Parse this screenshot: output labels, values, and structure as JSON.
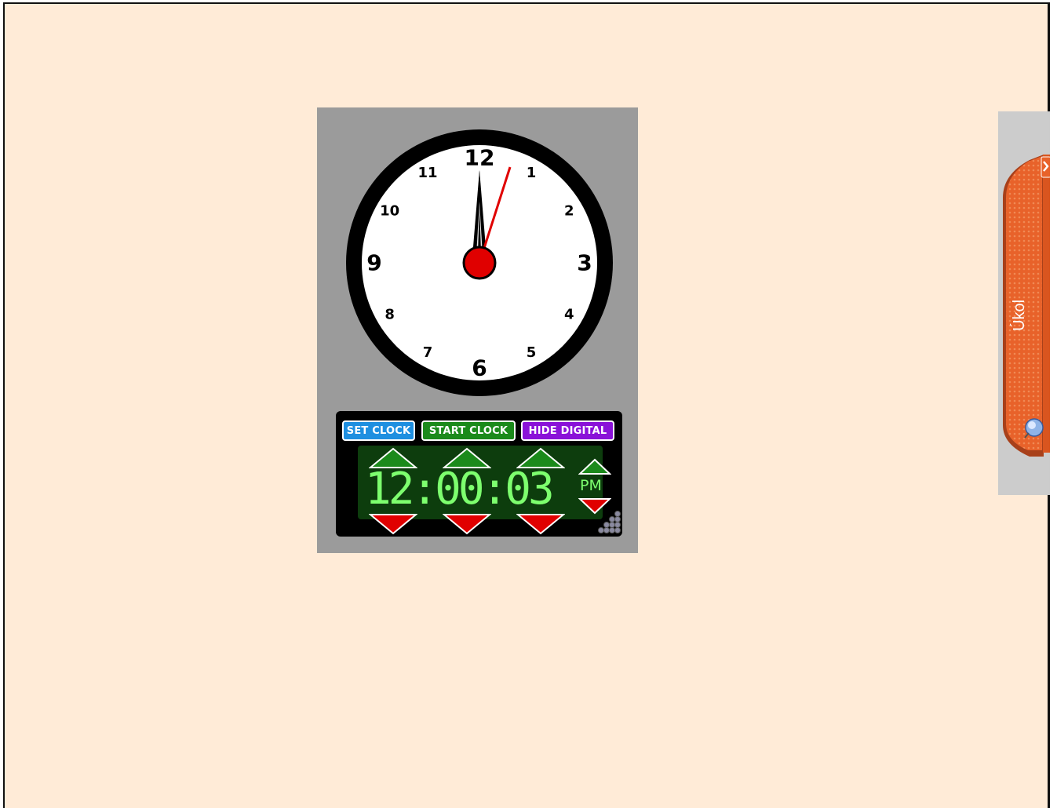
{
  "clock": {
    "face_numbers": [
      "12",
      "1",
      "2",
      "3",
      "4",
      "5",
      "6",
      "7",
      "8",
      "9",
      "10",
      "11"
    ],
    "time": {
      "hours": 12,
      "minutes": 0,
      "seconds": 3
    }
  },
  "controls": {
    "set_clock_label": "SET CLOCK",
    "start_clock_label": "START CLOCK",
    "hide_digital_label": "HIDE DIGITAL"
  },
  "digital": {
    "time_display": "12:00:03",
    "ampm": "PM"
  },
  "side_tab": {
    "label": "Úkol"
  },
  "colors": {
    "background": "#ffebd7",
    "widget_bg": "#9b9b9b",
    "set_clock": "#1e8fe0",
    "start_clock": "#1b8a1b",
    "hide_digital": "#8a12d8",
    "lcd_text": "#7dff6e",
    "tab_orange": "#e8622a"
  }
}
